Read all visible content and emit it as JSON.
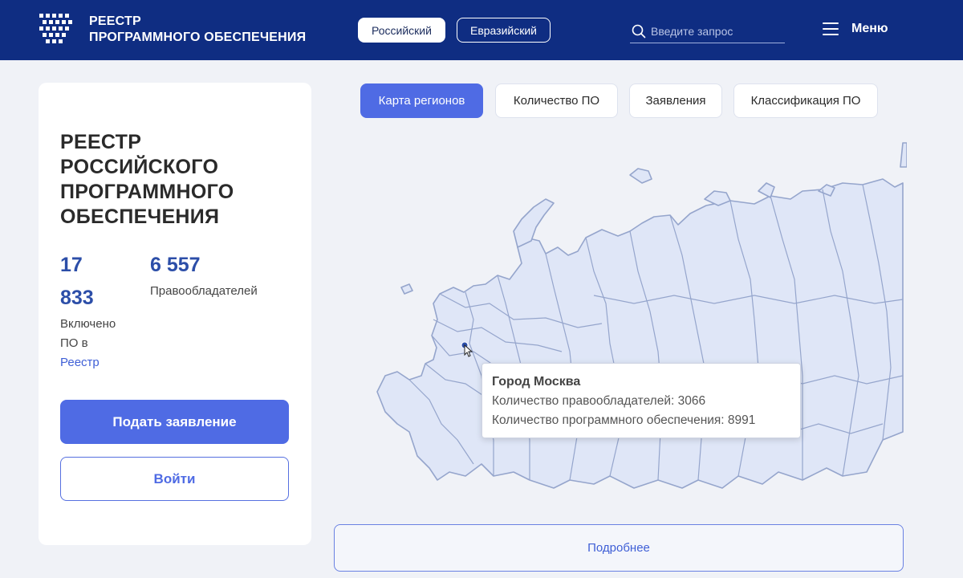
{
  "header": {
    "brand_line1": "РЕЕСТР",
    "brand_line2": "ПРОГРАММНОГО ОБЕСПЕЧЕНИЯ",
    "registry_toggle": {
      "options": [
        "Российский",
        "Евразийский"
      ],
      "selected": "Российский"
    },
    "search_placeholder": "Введите запрос",
    "menu_label": "Меню"
  },
  "sidebar_card": {
    "title": "РЕЕСТР РОССИЙСКОГО ПРОГРАММНОГО ОБЕСПЕЧЕНИЯ",
    "stats": [
      {
        "value": "17 833",
        "label": "Включено ПО в",
        "link": "Реестр"
      },
      {
        "value": "6 557",
        "label": "Правообладателей"
      }
    ],
    "apply_button": "Подать заявление",
    "login_button": "Войти"
  },
  "tabs": [
    {
      "label": "Карта регионов",
      "active": true
    },
    {
      "label": "Количество ПО",
      "active": false
    },
    {
      "label": "Заявления",
      "active": false
    },
    {
      "label": "Классификация ПО",
      "active": false
    }
  ],
  "map": {
    "hovered_region": "Город Москва",
    "tooltip_lines": [
      "Количество правообладателей: 3066",
      "Количество программного обеспечения: 8991"
    ]
  },
  "more_button": "Подробнее",
  "colors": {
    "header_bg": "#0f2d82",
    "accent": "#4f6be4",
    "map_fill": "#dfe6f7",
    "map_stroke": "#95a5cc"
  }
}
